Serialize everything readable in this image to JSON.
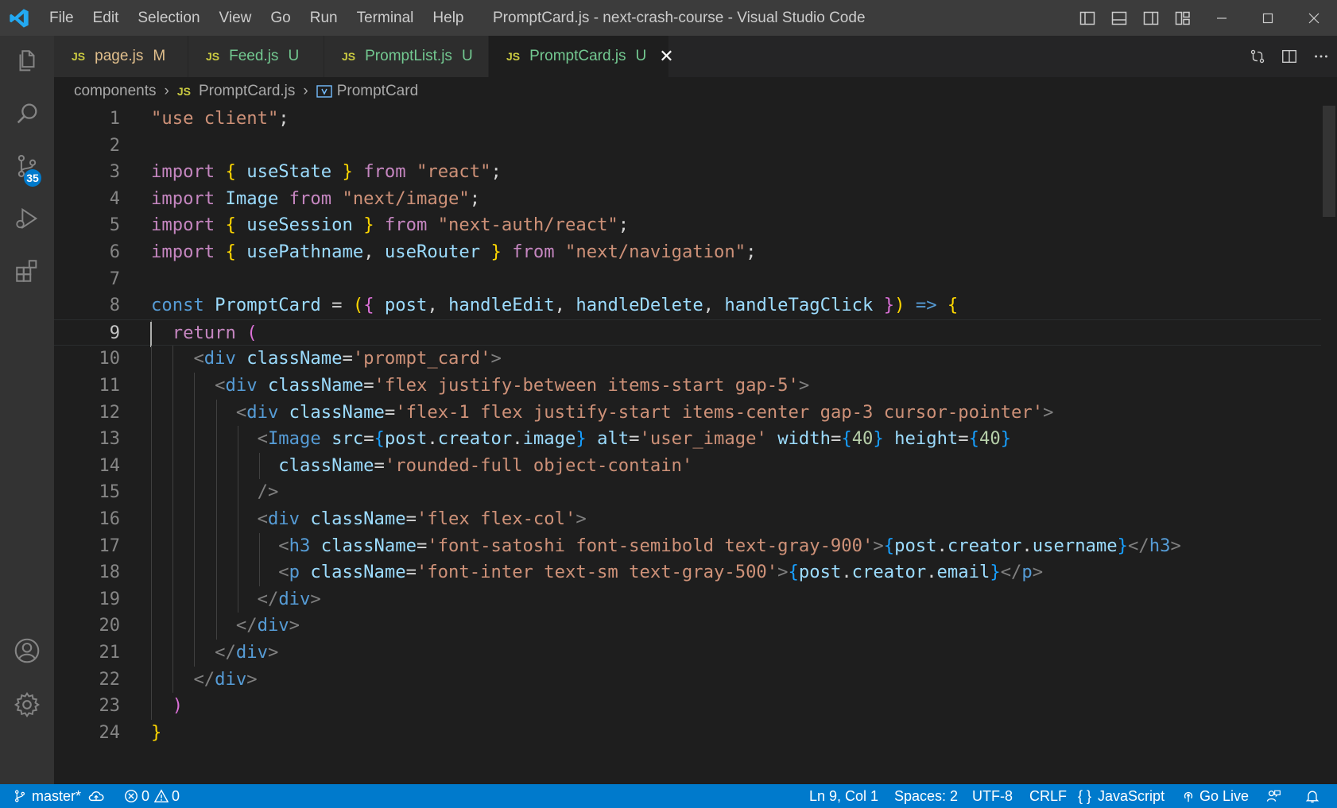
{
  "window": {
    "title": "PromptCard.js - next-crash-course - Visual Studio Code",
    "menu": [
      "File",
      "Edit",
      "Selection",
      "View",
      "Go",
      "Run",
      "Terminal",
      "Help"
    ]
  },
  "activity": {
    "scm_badge": "35",
    "icons": [
      "explorer-icon",
      "search-icon",
      "source-control-icon",
      "run-debug-icon",
      "extensions-icon",
      "account-icon",
      "settings-gear-icon"
    ]
  },
  "tabs": [
    {
      "icon": "JS",
      "label": "page.js",
      "status": "M",
      "label_color": "#e2c08d"
    },
    {
      "icon": "JS",
      "label": "Feed.js",
      "status": "U",
      "label_color": "#73c991"
    },
    {
      "icon": "JS",
      "label": "PromptList.js",
      "status": "U",
      "label_color": "#73c991"
    },
    {
      "icon": "JS",
      "label": "PromptCard.js",
      "status": "U",
      "label_color": "#73c991",
      "active": true
    }
  ],
  "breadcrumb": {
    "folder": "components",
    "file_icon": "JS",
    "file": "PromptCard.js",
    "symbol": "PromptCard"
  },
  "editor": {
    "current_line": 9,
    "lines": [
      [
        [
          "s",
          "\"use client\""
        ],
        [
          "d",
          ";"
        ]
      ],
      [],
      [
        [
          "c",
          "import"
        ],
        [
          "d",
          " "
        ],
        [
          "br1",
          "{"
        ],
        [
          "d",
          " "
        ],
        [
          "v",
          "useState"
        ],
        [
          "d",
          " "
        ],
        [
          "br1",
          "}"
        ],
        [
          "d",
          " "
        ],
        [
          "c",
          "from"
        ],
        [
          "d",
          " "
        ],
        [
          "s",
          "\"react\""
        ],
        [
          "d",
          ";"
        ]
      ],
      [
        [
          "c",
          "import"
        ],
        [
          "d",
          " "
        ],
        [
          "v",
          "Image"
        ],
        [
          "d",
          " "
        ],
        [
          "c",
          "from"
        ],
        [
          "d",
          " "
        ],
        [
          "s",
          "\"next/image\""
        ],
        [
          "d",
          ";"
        ]
      ],
      [
        [
          "c",
          "import"
        ],
        [
          "d",
          " "
        ],
        [
          "br1",
          "{"
        ],
        [
          "d",
          " "
        ],
        [
          "v",
          "useSession"
        ],
        [
          "d",
          " "
        ],
        [
          "br1",
          "}"
        ],
        [
          "d",
          " "
        ],
        [
          "c",
          "from"
        ],
        [
          "d",
          " "
        ],
        [
          "s",
          "\"next-auth/react\""
        ],
        [
          "d",
          ";"
        ]
      ],
      [
        [
          "c",
          "import"
        ],
        [
          "d",
          " "
        ],
        [
          "br1",
          "{"
        ],
        [
          "d",
          " "
        ],
        [
          "v",
          "usePathname"
        ],
        [
          "d",
          ", "
        ],
        [
          "v",
          "useRouter"
        ],
        [
          "d",
          " "
        ],
        [
          "br1",
          "}"
        ],
        [
          "d",
          " "
        ],
        [
          "c",
          "from"
        ],
        [
          "d",
          " "
        ],
        [
          "s",
          "\"next/navigation\""
        ],
        [
          "d",
          ";"
        ]
      ],
      [],
      [
        [
          "k",
          "const"
        ],
        [
          "d",
          " "
        ],
        [
          "v",
          "PromptCard"
        ],
        [
          "d",
          " = "
        ],
        [
          "br1",
          "("
        ],
        [
          "br2",
          "{"
        ],
        [
          "d",
          " "
        ],
        [
          "v",
          "post"
        ],
        [
          "d",
          ", "
        ],
        [
          "v",
          "handleEdit"
        ],
        [
          "d",
          ", "
        ],
        [
          "v",
          "handleDelete"
        ],
        [
          "d",
          ", "
        ],
        [
          "v",
          "handleTagClick"
        ],
        [
          "d",
          " "
        ],
        [
          "br2",
          "}"
        ],
        [
          "br1",
          ")"
        ],
        [
          "d",
          " "
        ],
        [
          "k",
          "=>"
        ],
        [
          "d",
          " "
        ],
        [
          "br1",
          "{"
        ]
      ],
      [
        [
          "d",
          "  "
        ],
        [
          "c",
          "return"
        ],
        [
          "d",
          " "
        ],
        [
          "br2",
          "("
        ]
      ],
      [
        [
          "d",
          "    "
        ],
        [
          "g",
          "<"
        ],
        [
          "t",
          "div"
        ],
        [
          "d",
          " "
        ],
        [
          "a",
          "className"
        ],
        [
          "d",
          "="
        ],
        [
          "s",
          "'prompt_card'"
        ],
        [
          "g",
          ">"
        ]
      ],
      [
        [
          "d",
          "      "
        ],
        [
          "g",
          "<"
        ],
        [
          "t",
          "div"
        ],
        [
          "d",
          " "
        ],
        [
          "a",
          "className"
        ],
        [
          "d",
          "="
        ],
        [
          "s",
          "'flex justify-between items-start gap-5'"
        ],
        [
          "g",
          ">"
        ]
      ],
      [
        [
          "d",
          "        "
        ],
        [
          "g",
          "<"
        ],
        [
          "t",
          "div"
        ],
        [
          "d",
          " "
        ],
        [
          "a",
          "className"
        ],
        [
          "d",
          "="
        ],
        [
          "s",
          "'flex-1 flex justify-start items-center gap-3 cursor-pointer'"
        ],
        [
          "g",
          ">"
        ]
      ],
      [
        [
          "d",
          "          "
        ],
        [
          "g",
          "<"
        ],
        [
          "t",
          "Image"
        ],
        [
          "d",
          " "
        ],
        [
          "a",
          "src"
        ],
        [
          "d",
          "="
        ],
        [
          "br3",
          "{"
        ],
        [
          "v",
          "post"
        ],
        [
          "d",
          "."
        ],
        [
          "v",
          "creator"
        ],
        [
          "d",
          "."
        ],
        [
          "v",
          "image"
        ],
        [
          "br3",
          "}"
        ],
        [
          "d",
          " "
        ],
        [
          "a",
          "alt"
        ],
        [
          "d",
          "="
        ],
        [
          "s",
          "'user_image'"
        ],
        [
          "d",
          " "
        ],
        [
          "a",
          "width"
        ],
        [
          "d",
          "="
        ],
        [
          "br3",
          "{"
        ],
        [
          "n",
          "40"
        ],
        [
          "br3",
          "}"
        ],
        [
          "d",
          " "
        ],
        [
          "a",
          "height"
        ],
        [
          "d",
          "="
        ],
        [
          "br3",
          "{"
        ],
        [
          "n",
          "40"
        ],
        [
          "br3",
          "}"
        ]
      ],
      [
        [
          "d",
          "            "
        ],
        [
          "a",
          "className"
        ],
        [
          "d",
          "="
        ],
        [
          "s",
          "'rounded-full object-contain'"
        ]
      ],
      [
        [
          "d",
          "          "
        ],
        [
          "g",
          "/>"
        ]
      ],
      [
        [
          "d",
          "          "
        ],
        [
          "g",
          "<"
        ],
        [
          "t",
          "div"
        ],
        [
          "d",
          " "
        ],
        [
          "a",
          "className"
        ],
        [
          "d",
          "="
        ],
        [
          "s",
          "'flex flex-col'"
        ],
        [
          "g",
          ">"
        ]
      ],
      [
        [
          "d",
          "            "
        ],
        [
          "g",
          "<"
        ],
        [
          "t",
          "h3"
        ],
        [
          "d",
          " "
        ],
        [
          "a",
          "className"
        ],
        [
          "d",
          "="
        ],
        [
          "s",
          "'font-satoshi font-semibold text-gray-900'"
        ],
        [
          "g",
          ">"
        ],
        [
          "br3",
          "{"
        ],
        [
          "v",
          "post"
        ],
        [
          "d",
          "."
        ],
        [
          "v",
          "creator"
        ],
        [
          "d",
          "."
        ],
        [
          "v",
          "username"
        ],
        [
          "br3",
          "}"
        ],
        [
          "g",
          "</"
        ],
        [
          "t",
          "h3"
        ],
        [
          "g",
          ">"
        ]
      ],
      [
        [
          "d",
          "            "
        ],
        [
          "g",
          "<"
        ],
        [
          "t",
          "p"
        ],
        [
          "d",
          " "
        ],
        [
          "a",
          "className"
        ],
        [
          "d",
          "="
        ],
        [
          "s",
          "'font-inter text-sm text-gray-500'"
        ],
        [
          "g",
          ">"
        ],
        [
          "br3",
          "{"
        ],
        [
          "v",
          "post"
        ],
        [
          "d",
          "."
        ],
        [
          "v",
          "creator"
        ],
        [
          "d",
          "."
        ],
        [
          "v",
          "email"
        ],
        [
          "br3",
          "}"
        ],
        [
          "g",
          "</"
        ],
        [
          "t",
          "p"
        ],
        [
          "g",
          ">"
        ]
      ],
      [
        [
          "d",
          "          "
        ],
        [
          "g",
          "</"
        ],
        [
          "t",
          "div"
        ],
        [
          "g",
          ">"
        ]
      ],
      [
        [
          "d",
          "        "
        ],
        [
          "g",
          "</"
        ],
        [
          "t",
          "div"
        ],
        [
          "g",
          ">"
        ]
      ],
      [
        [
          "d",
          "      "
        ],
        [
          "g",
          "</"
        ],
        [
          "t",
          "div"
        ],
        [
          "g",
          ">"
        ]
      ],
      [
        [
          "d",
          "    "
        ],
        [
          "g",
          "</"
        ],
        [
          "t",
          "div"
        ],
        [
          "g",
          ">"
        ]
      ],
      [
        [
          "d",
          "  "
        ],
        [
          "br2",
          ")"
        ]
      ],
      [
        [
          "br1",
          "}"
        ]
      ]
    ]
  },
  "status": {
    "branch": "master*",
    "errors": "0",
    "warnings": "0",
    "position": "Ln 9, Col 1",
    "spaces": "Spaces: 2",
    "encoding": "UTF-8",
    "eol": "CRLF",
    "language": "JavaScript",
    "golive": "Go Live"
  },
  "colors": {
    "accent": "#007acc",
    "titlebar": "#3c3c3c",
    "activitybar": "#333333",
    "editor": "#1e1e1e"
  }
}
